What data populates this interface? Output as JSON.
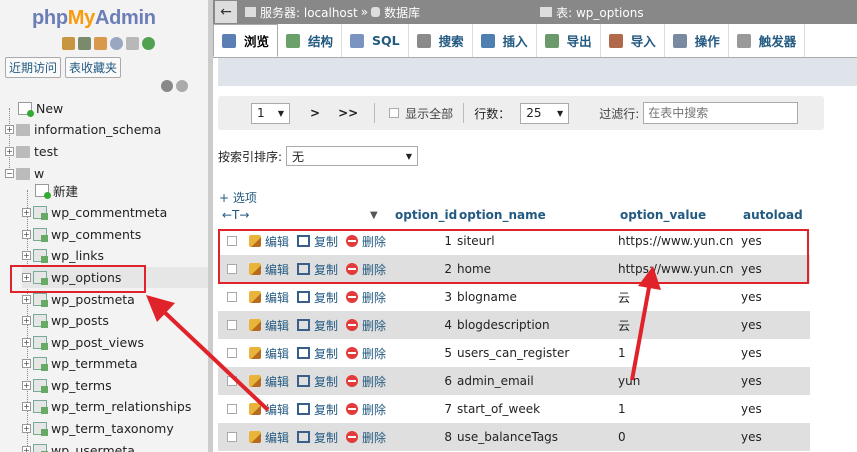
{
  "nav": {
    "logo": {
      "php": "php",
      "my": "My",
      "admin": "Admin"
    },
    "links": [
      "近期访问",
      "表收藏夹"
    ],
    "tree": [
      {
        "label": "New",
        "type": "new",
        "level": 0
      },
      {
        "label": "information_schema",
        "type": "db",
        "level": 0
      },
      {
        "label": "test",
        "type": "db",
        "level": 0
      },
      {
        "label": "w",
        "type": "db",
        "level": 0
      },
      {
        "label": "新建",
        "type": "new",
        "level": 1
      },
      {
        "label": "wp_commentmeta",
        "type": "table",
        "level": 1
      },
      {
        "label": "wp_comments",
        "type": "table",
        "level": 1
      },
      {
        "label": "wp_links",
        "type": "table",
        "level": 1
      },
      {
        "label": "wp_options",
        "type": "table",
        "level": 1
      },
      {
        "label": "wp_postmeta",
        "type": "table",
        "level": 1
      },
      {
        "label": "wp_posts",
        "type": "table",
        "level": 1
      },
      {
        "label": "wp_post_views",
        "type": "table",
        "level": 1
      },
      {
        "label": "wp_termmeta",
        "type": "table",
        "level": 1
      },
      {
        "label": "wp_terms",
        "type": "table",
        "level": 1
      },
      {
        "label": "wp_term_relationships",
        "type": "table",
        "level": 1
      },
      {
        "label": "wp_term_taxonomy",
        "type": "table",
        "level": 1
      },
      {
        "label": "wp_usermeta",
        "type": "table",
        "level": 1
      }
    ]
  },
  "breadcrumb": {
    "server": "服务器: localhost",
    "sep": "»",
    "db": "数据库",
    "table": "表: wp_options"
  },
  "tabs": [
    {
      "label": "浏览",
      "icon": "browse-icon",
      "color": "#5b7fb5"
    },
    {
      "label": "结构",
      "icon": "structure-icon",
      "color": "#6aa06a"
    },
    {
      "label": "SQL",
      "icon": "sql-icon",
      "color": "#7a93c0"
    },
    {
      "label": "搜索",
      "icon": "search-icon",
      "color": "#8a8a8a"
    },
    {
      "label": "插入",
      "icon": "insert-icon",
      "color": "#4f7fb0"
    },
    {
      "label": "导出",
      "icon": "export-icon",
      "color": "#6a9a6a"
    },
    {
      "label": "导入",
      "icon": "import-icon",
      "color": "#b06a4a"
    },
    {
      "label": "操作",
      "icon": "operations-icon",
      "color": "#7a8aa0"
    },
    {
      "label": "触发器",
      "icon": "triggers-icon",
      "color": "#999999"
    }
  ],
  "navctl": {
    "page": "1",
    "next": ">",
    "last": ">>",
    "show_all": "显示全部",
    "rows_label": "行数：",
    "rows": "25",
    "filter_label": "过滤行:",
    "filter_placeholder": "在表中搜索"
  },
  "sort": {
    "label": "按索引排序:",
    "value": "无"
  },
  "options_link": "+ 选项",
  "table": {
    "arrows": "←T→",
    "columns": [
      "option_id",
      "option_name",
      "option_value",
      "autoload"
    ],
    "actions": {
      "edit": "编辑",
      "copy": "复制",
      "delete": "删除"
    },
    "rows": [
      {
        "id": "1",
        "name": "siteurl",
        "value": "https://www.yun.cn",
        "autoload": "yes"
      },
      {
        "id": "2",
        "name": "home",
        "value": "https://www.yun.cn",
        "autoload": "yes"
      },
      {
        "id": "3",
        "name": "blogname",
        "value": "云",
        "autoload": "yes"
      },
      {
        "id": "4",
        "name": "blogdescription",
        "value": "云",
        "autoload": "yes"
      },
      {
        "id": "5",
        "name": "users_can_register",
        "value": "1",
        "autoload": "yes"
      },
      {
        "id": "6",
        "name": "admin_email",
        "value": "yun",
        "autoload": "yes"
      },
      {
        "id": "7",
        "name": "start_of_week",
        "value": "1",
        "autoload": "yes"
      },
      {
        "id": "8",
        "name": "use_balanceTags",
        "value": "0",
        "autoload": "yes"
      }
    ]
  },
  "colors": {
    "accent": "#235a81",
    "annotation": "#e0232a",
    "row_alt": "#dfdfdf",
    "header_bar": "#888888"
  }
}
